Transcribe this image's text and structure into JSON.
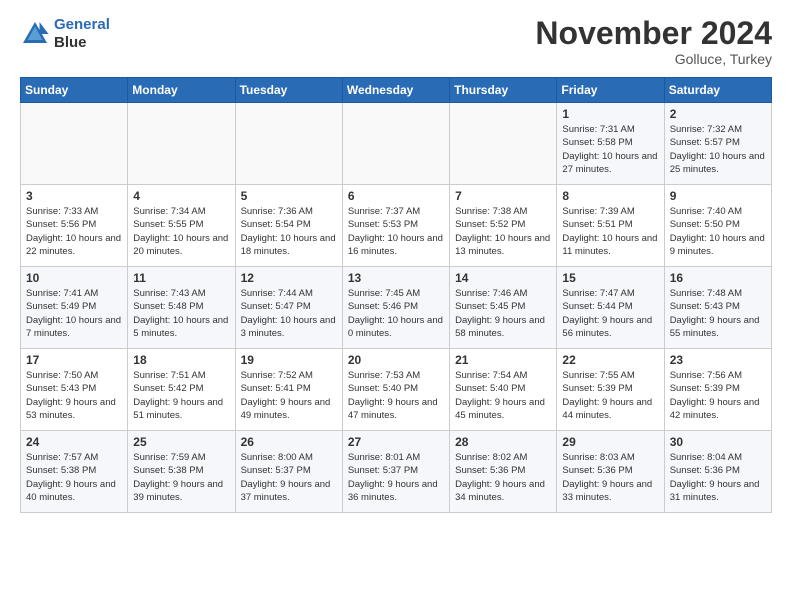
{
  "header": {
    "logo_line1": "General",
    "logo_line2": "Blue",
    "month": "November 2024",
    "location": "Golluce, Turkey"
  },
  "weekdays": [
    "Sunday",
    "Monday",
    "Tuesday",
    "Wednesday",
    "Thursday",
    "Friday",
    "Saturday"
  ],
  "weeks": [
    [
      {
        "day": "",
        "info": ""
      },
      {
        "day": "",
        "info": ""
      },
      {
        "day": "",
        "info": ""
      },
      {
        "day": "",
        "info": ""
      },
      {
        "day": "",
        "info": ""
      },
      {
        "day": "1",
        "info": "Sunrise: 7:31 AM\nSunset: 5:58 PM\nDaylight: 10 hours and 27 minutes."
      },
      {
        "day": "2",
        "info": "Sunrise: 7:32 AM\nSunset: 5:57 PM\nDaylight: 10 hours and 25 minutes."
      }
    ],
    [
      {
        "day": "3",
        "info": "Sunrise: 7:33 AM\nSunset: 5:56 PM\nDaylight: 10 hours and 22 minutes."
      },
      {
        "day": "4",
        "info": "Sunrise: 7:34 AM\nSunset: 5:55 PM\nDaylight: 10 hours and 20 minutes."
      },
      {
        "day": "5",
        "info": "Sunrise: 7:36 AM\nSunset: 5:54 PM\nDaylight: 10 hours and 18 minutes."
      },
      {
        "day": "6",
        "info": "Sunrise: 7:37 AM\nSunset: 5:53 PM\nDaylight: 10 hours and 16 minutes."
      },
      {
        "day": "7",
        "info": "Sunrise: 7:38 AM\nSunset: 5:52 PM\nDaylight: 10 hours and 13 minutes."
      },
      {
        "day": "8",
        "info": "Sunrise: 7:39 AM\nSunset: 5:51 PM\nDaylight: 10 hours and 11 minutes."
      },
      {
        "day": "9",
        "info": "Sunrise: 7:40 AM\nSunset: 5:50 PM\nDaylight: 10 hours and 9 minutes."
      }
    ],
    [
      {
        "day": "10",
        "info": "Sunrise: 7:41 AM\nSunset: 5:49 PM\nDaylight: 10 hours and 7 minutes."
      },
      {
        "day": "11",
        "info": "Sunrise: 7:43 AM\nSunset: 5:48 PM\nDaylight: 10 hours and 5 minutes."
      },
      {
        "day": "12",
        "info": "Sunrise: 7:44 AM\nSunset: 5:47 PM\nDaylight: 10 hours and 3 minutes."
      },
      {
        "day": "13",
        "info": "Sunrise: 7:45 AM\nSunset: 5:46 PM\nDaylight: 10 hours and 0 minutes."
      },
      {
        "day": "14",
        "info": "Sunrise: 7:46 AM\nSunset: 5:45 PM\nDaylight: 9 hours and 58 minutes."
      },
      {
        "day": "15",
        "info": "Sunrise: 7:47 AM\nSunset: 5:44 PM\nDaylight: 9 hours and 56 minutes."
      },
      {
        "day": "16",
        "info": "Sunrise: 7:48 AM\nSunset: 5:43 PM\nDaylight: 9 hours and 55 minutes."
      }
    ],
    [
      {
        "day": "17",
        "info": "Sunrise: 7:50 AM\nSunset: 5:43 PM\nDaylight: 9 hours and 53 minutes."
      },
      {
        "day": "18",
        "info": "Sunrise: 7:51 AM\nSunset: 5:42 PM\nDaylight: 9 hours and 51 minutes."
      },
      {
        "day": "19",
        "info": "Sunrise: 7:52 AM\nSunset: 5:41 PM\nDaylight: 9 hours and 49 minutes."
      },
      {
        "day": "20",
        "info": "Sunrise: 7:53 AM\nSunset: 5:40 PM\nDaylight: 9 hours and 47 minutes."
      },
      {
        "day": "21",
        "info": "Sunrise: 7:54 AM\nSunset: 5:40 PM\nDaylight: 9 hours and 45 minutes."
      },
      {
        "day": "22",
        "info": "Sunrise: 7:55 AM\nSunset: 5:39 PM\nDaylight: 9 hours and 44 minutes."
      },
      {
        "day": "23",
        "info": "Sunrise: 7:56 AM\nSunset: 5:39 PM\nDaylight: 9 hours and 42 minutes."
      }
    ],
    [
      {
        "day": "24",
        "info": "Sunrise: 7:57 AM\nSunset: 5:38 PM\nDaylight: 9 hours and 40 minutes."
      },
      {
        "day": "25",
        "info": "Sunrise: 7:59 AM\nSunset: 5:38 PM\nDaylight: 9 hours and 39 minutes."
      },
      {
        "day": "26",
        "info": "Sunrise: 8:00 AM\nSunset: 5:37 PM\nDaylight: 9 hours and 37 minutes."
      },
      {
        "day": "27",
        "info": "Sunrise: 8:01 AM\nSunset: 5:37 PM\nDaylight: 9 hours and 36 minutes."
      },
      {
        "day": "28",
        "info": "Sunrise: 8:02 AM\nSunset: 5:36 PM\nDaylight: 9 hours and 34 minutes."
      },
      {
        "day": "29",
        "info": "Sunrise: 8:03 AM\nSunset: 5:36 PM\nDaylight: 9 hours and 33 minutes."
      },
      {
        "day": "30",
        "info": "Sunrise: 8:04 AM\nSunset: 5:36 PM\nDaylight: 9 hours and 31 minutes."
      }
    ]
  ]
}
